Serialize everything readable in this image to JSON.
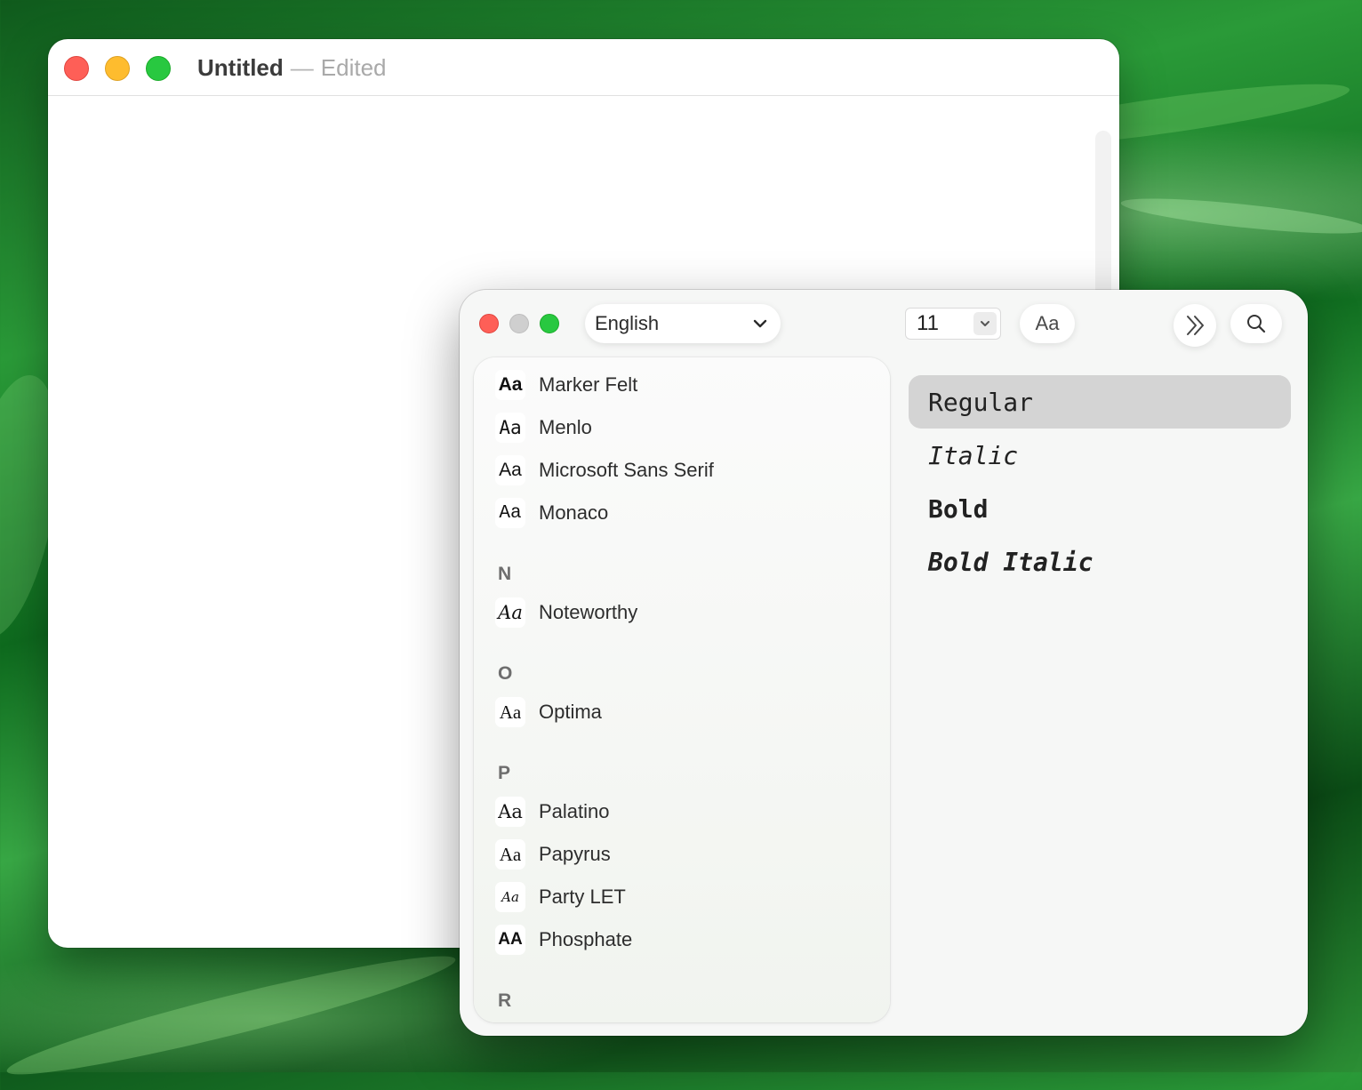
{
  "document": {
    "title": "Untitled",
    "separator": "—",
    "status": "Edited"
  },
  "font_panel": {
    "language": "English",
    "size": "11",
    "aa_button": "Aa",
    "family_sections": [
      {
        "header": "",
        "families": [
          {
            "icon": "Aa",
            "name": "Marker Felt"
          },
          {
            "icon": "Aa",
            "name": "Menlo"
          },
          {
            "icon": "Aa",
            "name": "Microsoft Sans Serif"
          },
          {
            "icon": "Aa",
            "name": "Monaco"
          }
        ]
      },
      {
        "header": "N",
        "families": [
          {
            "icon": "Aa",
            "name": "Noteworthy"
          }
        ]
      },
      {
        "header": "O",
        "families": [
          {
            "icon": "Aa",
            "name": "Optima"
          }
        ]
      },
      {
        "header": "P",
        "families": [
          {
            "icon": "Aa",
            "name": "Palatino"
          },
          {
            "icon": "Aa",
            "name": "Papyrus"
          },
          {
            "icon": "Aa",
            "name": "Party LET"
          },
          {
            "icon": "AA",
            "name": "Phosphate"
          }
        ]
      },
      {
        "header": "R",
        "families": []
      }
    ],
    "styles": [
      {
        "label": "Regular",
        "selected": true
      },
      {
        "label": "Italic",
        "selected": false
      },
      {
        "label": "Bold",
        "selected": false
      },
      {
        "label": "Bold Italic",
        "selected": false
      }
    ]
  },
  "icons": {
    "lang_dropdown": "chevron-down-icon",
    "size_stepper": "chevron-down-icon",
    "more": "double-chevron-right-icon",
    "search": "search-icon"
  },
  "colors": {
    "close": "#fe5f57",
    "minimize": "#febc2e",
    "zoom": "#28c840",
    "selected_style_bg": "#d4d4d4"
  }
}
